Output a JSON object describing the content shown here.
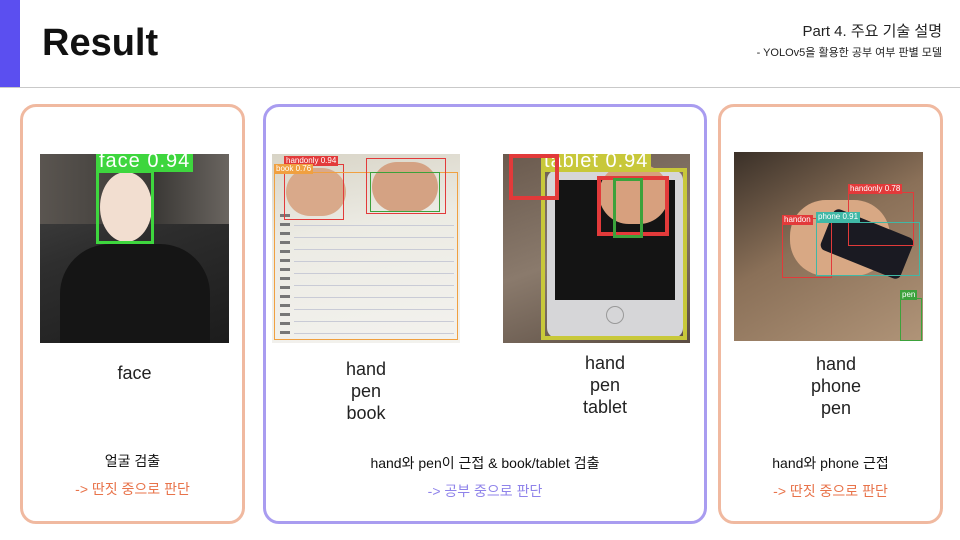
{
  "header": {
    "title": "Result",
    "part": "Part 4. 주요 기술 설명",
    "subtitle": "- YOLOv5을 활용한 공부 여부 판별 모델"
  },
  "panels": {
    "face": {
      "detect_tag": "face 0.94",
      "labels": [
        "face"
      ],
      "desc": "얼굴 검출",
      "verdict": "-> 딴짓 중으로 판단"
    },
    "study": {
      "book_image": {
        "tags": [
          "handonly 0.94",
          "book 0.76"
        ],
        "labels": [
          "hand",
          "pen",
          "book"
        ]
      },
      "tablet_image": {
        "tags": [
          "tablet 0.94"
        ],
        "labels": [
          "hand",
          "pen",
          "tablet"
        ]
      },
      "desc": "hand와 pen이 근접 & book/tablet 검출",
      "verdict": "-> 공부 중으로 판단"
    },
    "phone": {
      "tags": [
        "handonly 0.78",
        "handon",
        "phone 0.91",
        "pen"
      ],
      "labels": [
        "hand",
        "phone",
        "pen"
      ],
      "desc": "hand와 phone 근접",
      "verdict": "-> 딴짓 중으로 판단"
    }
  },
  "colors": {
    "accent": "#5b4ff0",
    "panel_orange": "#f0b9a0",
    "panel_purple": "#a99cf0",
    "verdict_orange": "#e8734a",
    "verdict_purple": "#8f83ea",
    "box_green": "#3ed63e",
    "box_red": "#e23a3a",
    "box_olive": "#c8c83a",
    "box_teal": "#3fb8a6"
  }
}
